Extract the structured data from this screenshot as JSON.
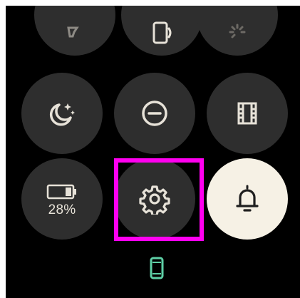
{
  "tiles": {
    "flashlight": {
      "icon": "flashlight-icon"
    },
    "phone_connect": {
      "icon": "phone-connection-icon"
    },
    "brightness": {
      "icon": "brightness-icon"
    },
    "bedtime": {
      "icon": "bedtime-moon-icon"
    },
    "do_not_disturb": {
      "icon": "do-not-disturb-icon"
    },
    "theater_mode": {
      "icon": "theater-mode-film-icon"
    },
    "battery": {
      "icon": "battery-icon",
      "percent_label": "28%",
      "level": 0.28
    },
    "settings": {
      "icon": "gear-icon"
    },
    "notifications": {
      "icon": "bell-icon"
    }
  },
  "status": {
    "phone_connected_icon": "phone-status-icon",
    "phone_color": "#5ecfa6"
  },
  "highlight_color": "#ff00f0"
}
